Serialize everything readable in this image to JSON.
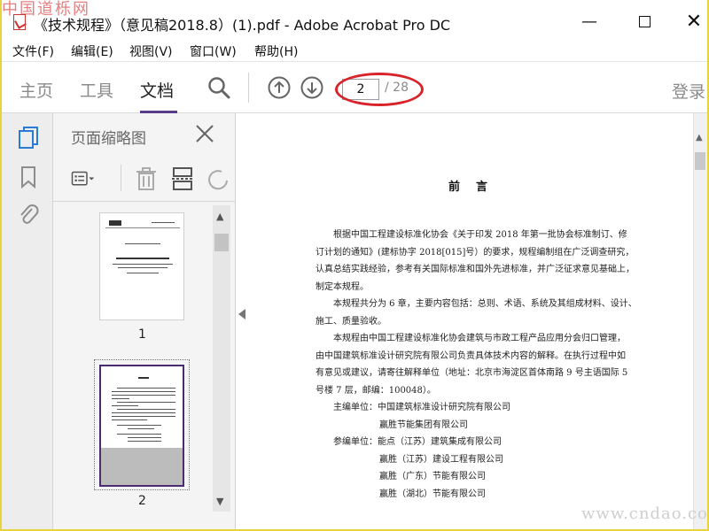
{
  "watermark_top": "中国道栎网",
  "window": {
    "title": "《技术规程》（意见稿2018.8）(1).pdf - Adobe Acrobat Pro DC",
    "minimize": "—",
    "close": "✕"
  },
  "menu": [
    "文件(F)",
    "编辑(E)",
    "视图(V)",
    "窗口(W)",
    "帮助(H)"
  ],
  "toolbar": {
    "tabs": [
      "主页",
      "工具",
      "文档"
    ],
    "active_tab": "文档",
    "page_current": "2",
    "page_total": "/ 28",
    "login": "登录",
    "annotation_color": "#d8232a"
  },
  "panel": {
    "title": "页面缩略图",
    "thumbnails": [
      {
        "number": "1"
      },
      {
        "number": "2"
      }
    ]
  },
  "document": {
    "heading": "前言",
    "lines": [
      {
        "indent": 1,
        "text": "根据中国工程建设标准化协会《关于印发 2018 年第一批协会标准制订、修"
      },
      {
        "indent": 0,
        "text": "订计划的通知》(建标协字 2018[015]号）的要求，规程编制组在广泛调查研究，"
      },
      {
        "indent": 0,
        "text": "认真总结实践经验，参考有关国际标准和国外先进标准，并广泛征求意见基础上，"
      },
      {
        "indent": 0,
        "text": "制定本规程。"
      },
      {
        "indent": 1,
        "text": "本规程共分为 6 章，主要内容包括：总则、术语、系统及其组成材料、设计、"
      },
      {
        "indent": 0,
        "text": "施工、质量验收。"
      },
      {
        "indent": 1,
        "text": "本规程由中国工程建设标准化协会建筑与市政工程产品应用分会归口管理，"
      },
      {
        "indent": 0,
        "text": "由中国建筑标准设计研究院有限公司负责具体技术内容的解释。在执行过程中如"
      },
      {
        "indent": 0,
        "text": "有意见或建议，请寄往解释单位（地址：北京市海淀区首体南路 9 号主语国际 5"
      },
      {
        "indent": 0,
        "text": "号楼 7 层，邮编：100048）。"
      },
      {
        "indent": 1,
        "text": "主编单位：中国建筑标准设计研究院有限公司"
      },
      {
        "indent": 2,
        "text": "赢胜节能集团有限公司"
      },
      {
        "indent": 1,
        "text": "参编单位：能点（江苏）建筑集成有限公司"
      },
      {
        "indent": 2,
        "text": "赢胜（江苏）建设工程有限公司"
      },
      {
        "indent": 2,
        "text": "赢胜（广东）节能有限公司"
      },
      {
        "indent": 2,
        "text": "赢胜（湖北）节能有限公司"
      }
    ]
  },
  "watermark_bottom": "www.cndao.com"
}
